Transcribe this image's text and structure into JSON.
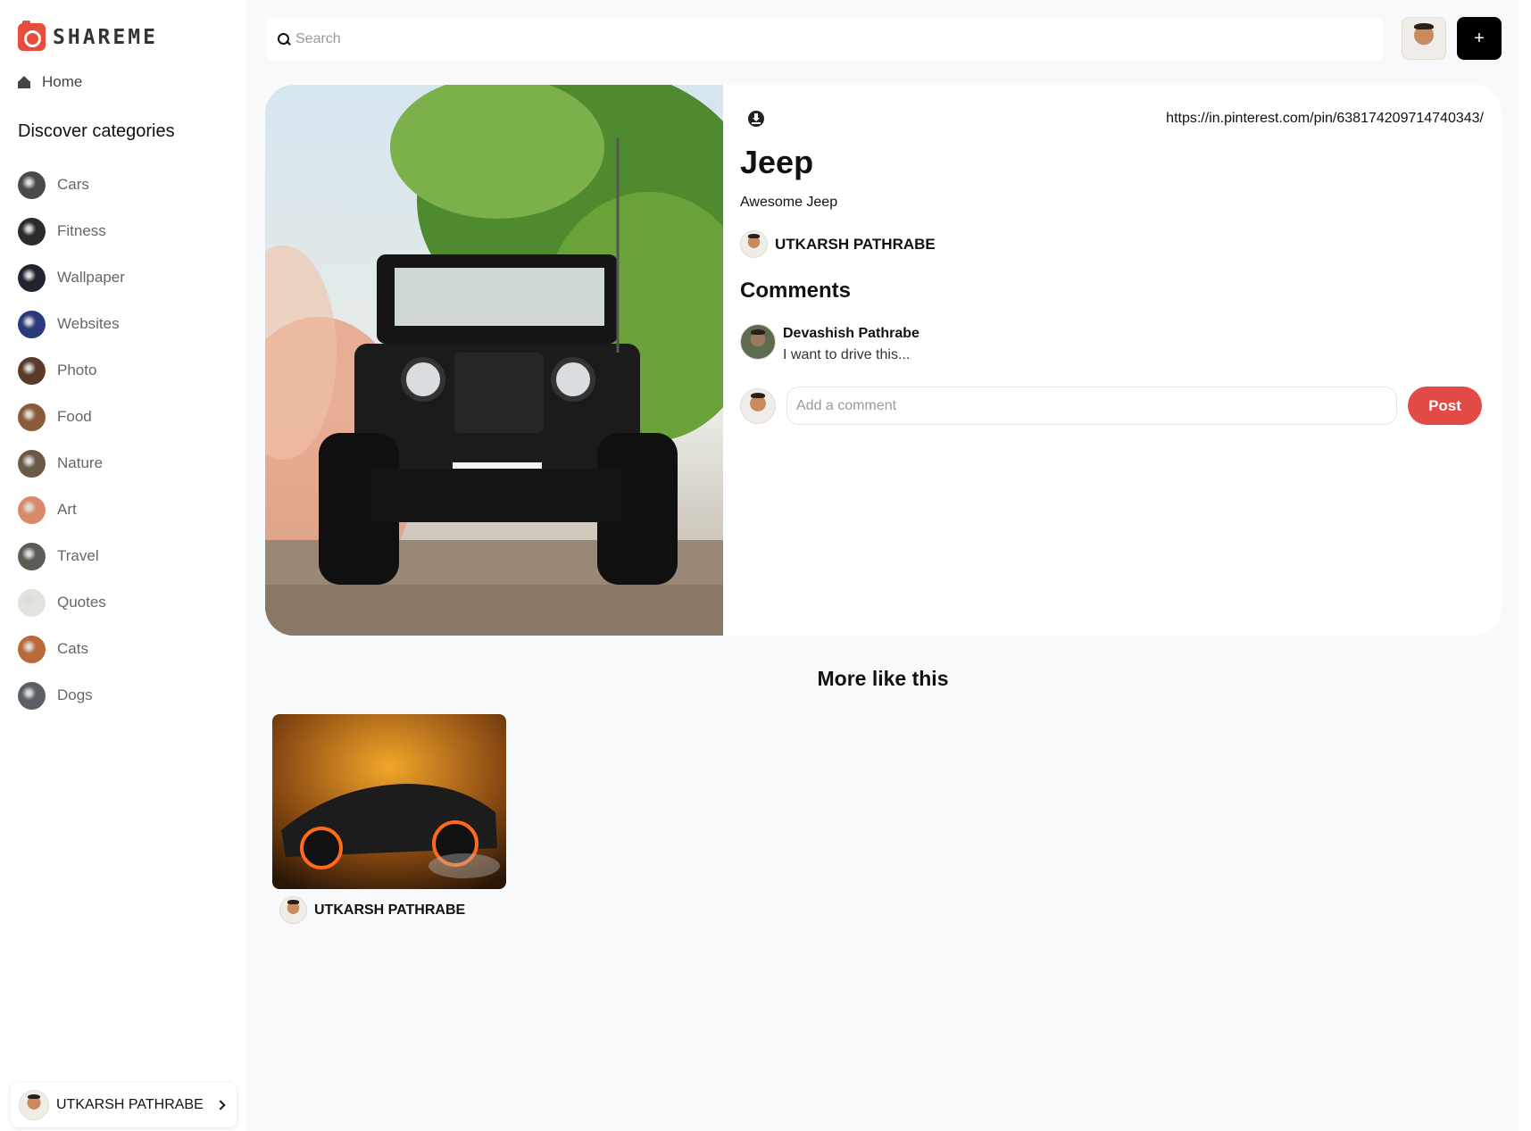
{
  "app": {
    "logo_text": "SHAREME"
  },
  "sidebar": {
    "home_label": "Home",
    "discover_title": "Discover categories",
    "categories": [
      {
        "label": "Cars",
        "color": "#4a4a4a"
      },
      {
        "label": "Fitness",
        "color": "#2b2b2b"
      },
      {
        "label": "Wallpaper",
        "color": "#1f2430"
      },
      {
        "label": "Websites",
        "color": "#2a3a7a"
      },
      {
        "label": "Photo",
        "color": "#5a3a28"
      },
      {
        "label": "Food",
        "color": "#8a5a3a"
      },
      {
        "label": "Nature",
        "color": "#6a5848"
      },
      {
        "label": "Art",
        "color": "#d88a6a"
      },
      {
        "label": "Travel",
        "color": "#5c5c54"
      },
      {
        "label": "Quotes",
        "color": "#e4e2dc"
      },
      {
        "label": "Cats",
        "color": "#b86a3a"
      },
      {
        "label": "Dogs",
        "color": "#5a5f66"
      }
    ],
    "user_name": "UTKARSH PATHRABE"
  },
  "search": {
    "placeholder": "Search",
    "value": ""
  },
  "topbar": {
    "add_label": "+"
  },
  "pin": {
    "link": "https://in.pinterest.com/pin/638174209714740343/",
    "title": "Jeep",
    "description": "Awesome Jeep",
    "author": "UTKARSH PATHRABE",
    "comments_heading": "Comments",
    "comments": [
      {
        "name": "Devashish Pathrabe",
        "text": "I want to drive this..."
      }
    ],
    "comment_placeholder": "Add a comment",
    "post_label": "Post"
  },
  "more": {
    "heading": "More like this",
    "items": [
      {
        "author": "UTKARSH PATHRABE"
      }
    ]
  },
  "colors": {
    "accent": "#e24b45",
    "logo": "#e74c3c"
  }
}
